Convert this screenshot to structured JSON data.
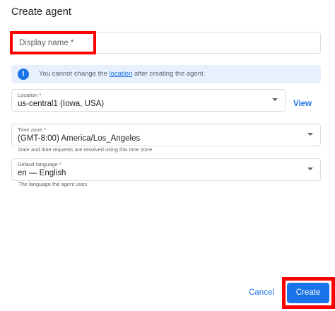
{
  "dialog": {
    "title": "Create agent"
  },
  "display_name": {
    "placeholder": "Display name *"
  },
  "info_banner": {
    "text_before": "You cannot change the ",
    "link_text": "location",
    "text_after": " after creating the agent.",
    "icon": "info-icon"
  },
  "location": {
    "label": "Location *",
    "value": "us-central1 (Iowa, USA)",
    "view_label": "View"
  },
  "time_zone": {
    "label": "Time zone *",
    "value": "(GMT-8:00) America/Los_Angeles",
    "hint": "Date and time requests are resolved using this time zone"
  },
  "default_language": {
    "label": "Default language *",
    "value": "en — English",
    "hint": "The language the agent uses"
  },
  "actions": {
    "cancel_label": "Cancel",
    "create_label": "Create"
  },
  "colors": {
    "accent": "#1a73e8",
    "highlight": "#ff0000",
    "banner_bg": "#e8f0fe"
  }
}
